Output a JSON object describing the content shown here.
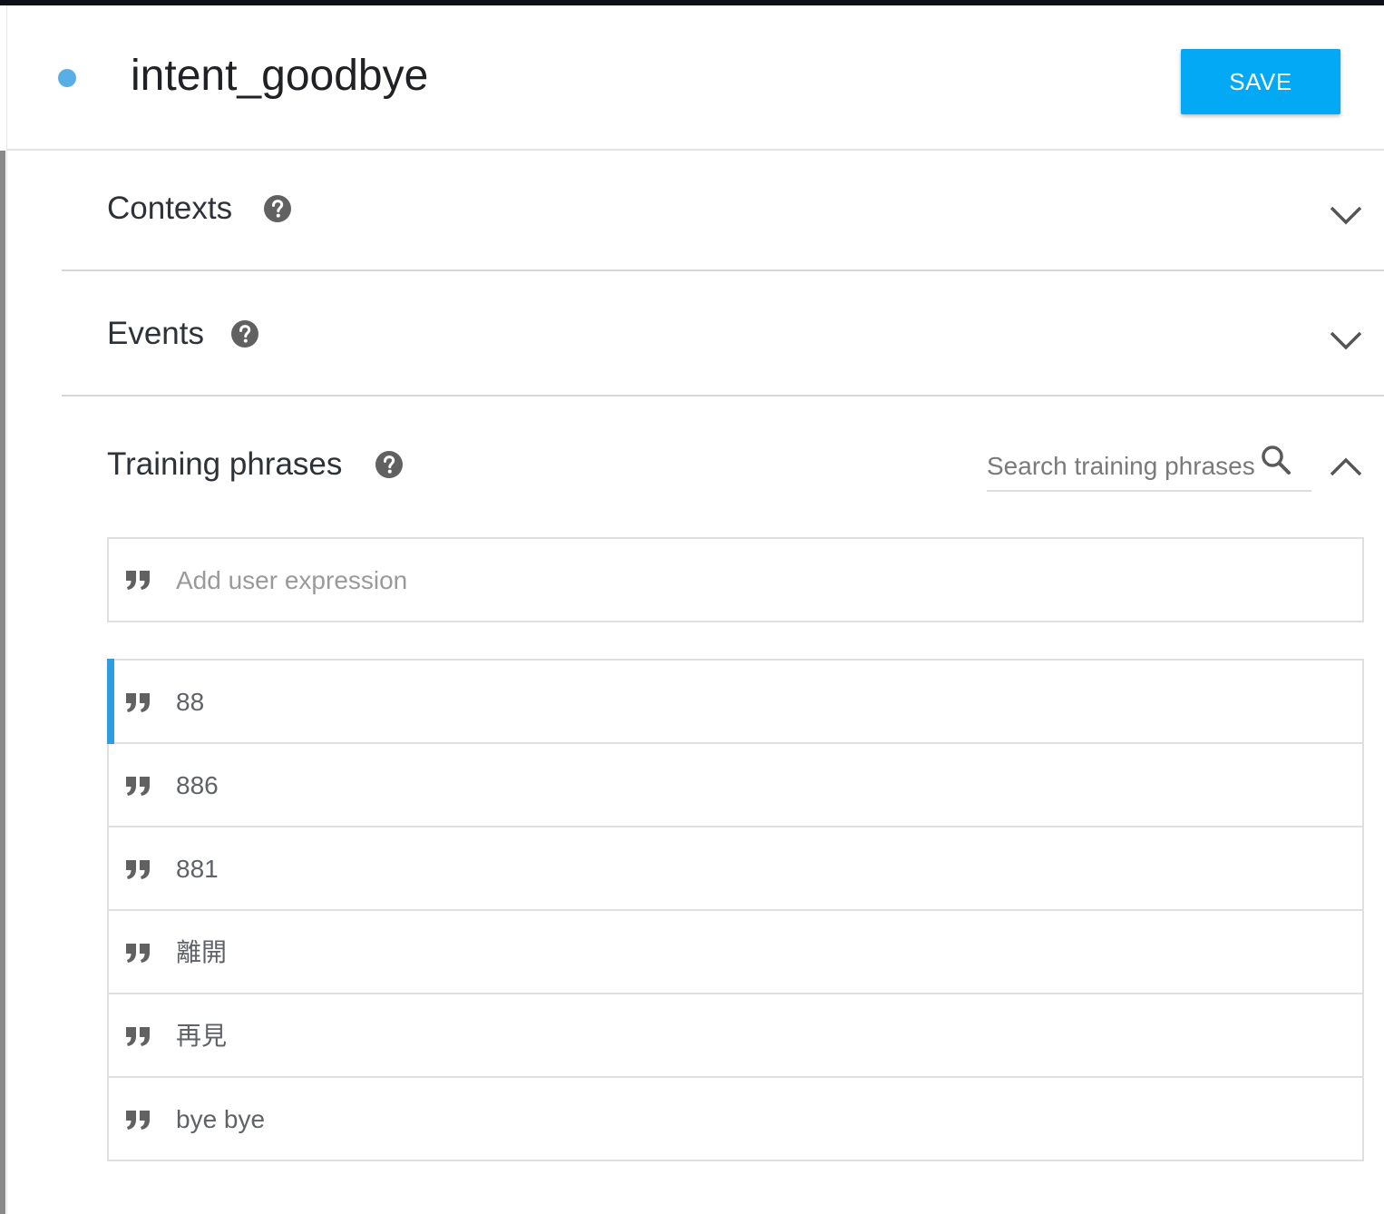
{
  "intent": {
    "name": "intent_goodbye",
    "save_label": "SAVE"
  },
  "sections": {
    "contexts": {
      "title": "Contexts"
    },
    "events": {
      "title": "Events"
    },
    "training": {
      "title": "Training phrases",
      "search_placeholder": "Search training phrases",
      "add_placeholder": "Add user expression",
      "phrases": [
        "88",
        "886",
        "881",
        "離開",
        "再見",
        "bye bye"
      ]
    }
  },
  "icons": {
    "help": "help-circle-icon",
    "expand": "chevron-down-icon",
    "collapse": "chevron-up-icon",
    "search": "search-icon",
    "quote": "quote-icon"
  },
  "colors": {
    "accent": "#03a9f4",
    "status_dot": "#5aaee6",
    "active_bar": "#2f9ee0",
    "icon": "#616161"
  }
}
